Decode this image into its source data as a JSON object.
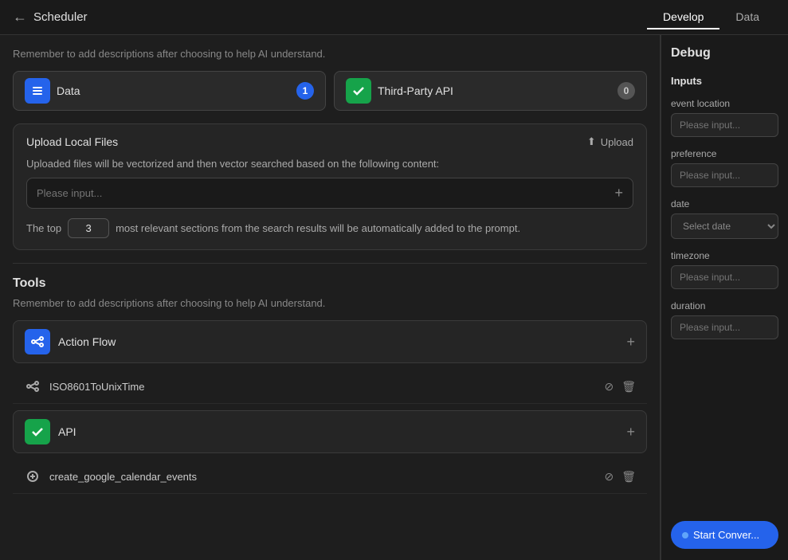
{
  "nav": {
    "back_icon": "←",
    "title": "Scheduler",
    "tabs": [
      {
        "label": "Develop",
        "active": true
      },
      {
        "label": "Data",
        "active": false
      }
    ]
  },
  "main": {
    "hint_text": "Remember to add descriptions after choosing to help AI understand.",
    "sources": [
      {
        "id": "data",
        "icon": "≡",
        "icon_style": "blue",
        "label": "Data",
        "badge": "1",
        "badge_style": "blue-badge"
      },
      {
        "id": "third_party",
        "icon": "✓",
        "icon_style": "green",
        "label": "Third-Party API",
        "badge": "0",
        "badge_style": "gray-badge"
      }
    ],
    "upload": {
      "title": "Upload Local Files",
      "upload_btn_label": "Upload",
      "upload_icon": "⬆",
      "vectorize_text": "Uploaded files will be vectorized and then vector searched based on the following content:",
      "search_placeholder": "Please input...",
      "top_k": {
        "prefix": "The top",
        "value": "3",
        "suffix": "most relevant sections from the search results will be automatically added to the prompt."
      }
    },
    "tools": {
      "title": "Tools",
      "hint_text": "Remember to add descriptions after choosing to help AI understand.",
      "tool_groups": [
        {
          "id": "action_flow",
          "icon": "⇄",
          "icon_style": "blue",
          "label": "Action Flow",
          "type": "add"
        },
        {
          "id": "iso_tool",
          "icon": "⇄",
          "icon_style": "gray",
          "label": "ISO8601ToUnixTime",
          "type": "item"
        },
        {
          "id": "api",
          "icon": "✓",
          "icon_style": "green",
          "label": "API",
          "type": "add"
        },
        {
          "id": "create_google",
          "icon": "⚙",
          "icon_style": "gray",
          "label": "create_google_calendar_events",
          "type": "item"
        }
      ]
    }
  },
  "debug_panel": {
    "title": "Debug",
    "inputs_label": "Inputs",
    "fields": [
      {
        "id": "event_location",
        "label": "event location",
        "placeholder": "Please input...",
        "type": "text"
      },
      {
        "id": "preference",
        "label": "preference",
        "placeholder": "Please input...",
        "type": "text"
      },
      {
        "id": "date",
        "label": "date",
        "placeholder": "Select date",
        "type": "date"
      },
      {
        "id": "timezone",
        "label": "timezone",
        "placeholder": "Please input...",
        "type": "text"
      },
      {
        "id": "duration",
        "label": "duration",
        "placeholder": "Please input...",
        "type": "text"
      }
    ],
    "start_btn_label": "Start Conver..."
  }
}
